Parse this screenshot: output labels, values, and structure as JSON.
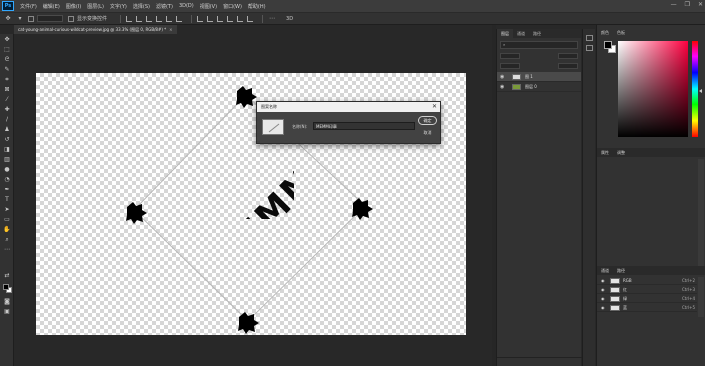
{
  "menu": {
    "logo": "Ps",
    "items": [
      "文件(F)",
      "编辑(E)",
      "图像(I)",
      "图层(L)",
      "文字(Y)",
      "选择(S)",
      "滤镜(T)",
      "3D(D)",
      "视图(V)",
      "窗口(W)",
      "帮助(H)"
    ],
    "minimize": "—",
    "maximize": "❐",
    "close": "✕"
  },
  "options": {
    "auto_select_label": "显示变换控件"
  },
  "document": {
    "tab_label": "cat-young-animal-curious-wildcat-preview.jpg @ 33.3% (图层 0, RGB/8#) *",
    "stamp_text": "MEMM"
  },
  "dialog": {
    "title": "图案名称",
    "close_glyph": "✕",
    "name_label": "名称(N):",
    "name_value": "MEMM印章",
    "ok_label": "确定",
    "cancel_label": "取消"
  },
  "layers_panel": {
    "tabs": [
      "图层",
      "通道",
      "路径"
    ],
    "layers": [
      {
        "name": "图 1",
        "selected": true,
        "thumb": "plain"
      },
      {
        "name": "图层 0",
        "selected": false,
        "thumb": "green"
      }
    ]
  },
  "color_panel": {
    "tabs": [
      "颜色",
      "色板"
    ],
    "colors": {
      "hue": "#ff0040",
      "accent": "#31a8ff"
    }
  },
  "properties_panel": {
    "tabs": [
      "属性",
      "调整"
    ]
  },
  "channels_panel": {
    "tabs": [
      "通道",
      "路径"
    ],
    "channels": [
      {
        "name": "RGB",
        "key": "Ctrl+2"
      },
      {
        "name": "红",
        "key": "Ctrl+3"
      },
      {
        "name": "绿",
        "key": "Ctrl+4"
      },
      {
        "name": "蓝",
        "key": "Ctrl+5"
      }
    ]
  }
}
